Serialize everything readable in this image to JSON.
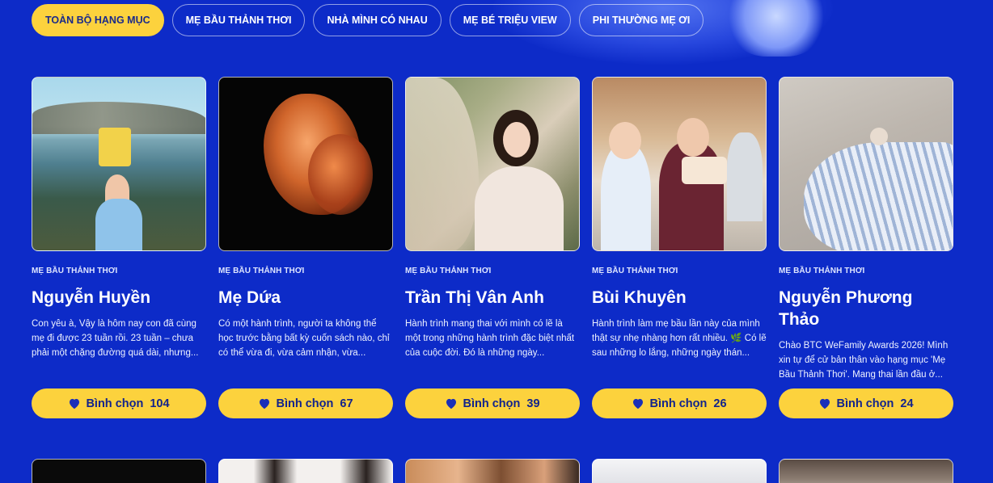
{
  "tabs": [
    {
      "label": "TOÀN BỘ HẠNG MỤC",
      "active": true
    },
    {
      "label": "MẸ BẦU THẢNH THƠI",
      "active": false
    },
    {
      "label": "NHÀ MÌNH CÓ NHAU",
      "active": false
    },
    {
      "label": "MẸ BÉ TRIỆU VIEW",
      "active": false
    },
    {
      "label": "PHI THƯỜNG MẸ ƠI",
      "active": false
    }
  ],
  "vote_label": "Bình chọn",
  "cards": [
    {
      "category": "MẸ BẦU THẢNH THƠI",
      "name": "Nguyễn Huyền",
      "description": "Con yêu à, Vậy là hôm nay con đã cùng mẹ đi được 23 tuần rồi. 23 tuần – chưa phải một chặng đường quá dài, nhưng...",
      "votes": "104"
    },
    {
      "category": "MẸ BẦU THẢNH THƠI",
      "name": "Mẹ Dứa",
      "description": "Có một hành trình, người ta không thể học trước bằng bất kỳ cuốn sách nào, chỉ có thể vừa đi, vừa cảm nhận, vừa...",
      "votes": "67"
    },
    {
      "category": "MẸ BẦU THẢNH THƠI",
      "name": "Trần Thị Vân Anh",
      "description": "Hành trình mang thai với mình có lẽ là một trong những hành trình đặc biệt nhất của cuộc đời. Đó là những ngày...",
      "votes": "39"
    },
    {
      "category": "MẸ BẦU THẢNH THƠI",
      "name": "Bùi Khuyên",
      "description": "Hành trình làm mẹ bầu lần này của mình thật sự nhẹ nhàng hơn rất nhiều. 🌿 Có lẽ sau những lo lắng, những ngày thán...",
      "votes": "26"
    },
    {
      "category": "MẸ BẦU THẢNH THƠI",
      "name": "Nguyễn Phương Thảo",
      "description": "Chào BTC WeFamily Awards 2026! Mình xin tự để cử bản thân vào hạng mục 'Mẹ Bầu Thảnh Thơi'. Mang thai lần đầu ở...",
      "votes": "24"
    }
  ],
  "colors": {
    "background": "#0d2bc8",
    "accent_yellow": "#fcd23d",
    "button_text": "#12238c"
  },
  "icons": {
    "vote": "heart-icon"
  }
}
